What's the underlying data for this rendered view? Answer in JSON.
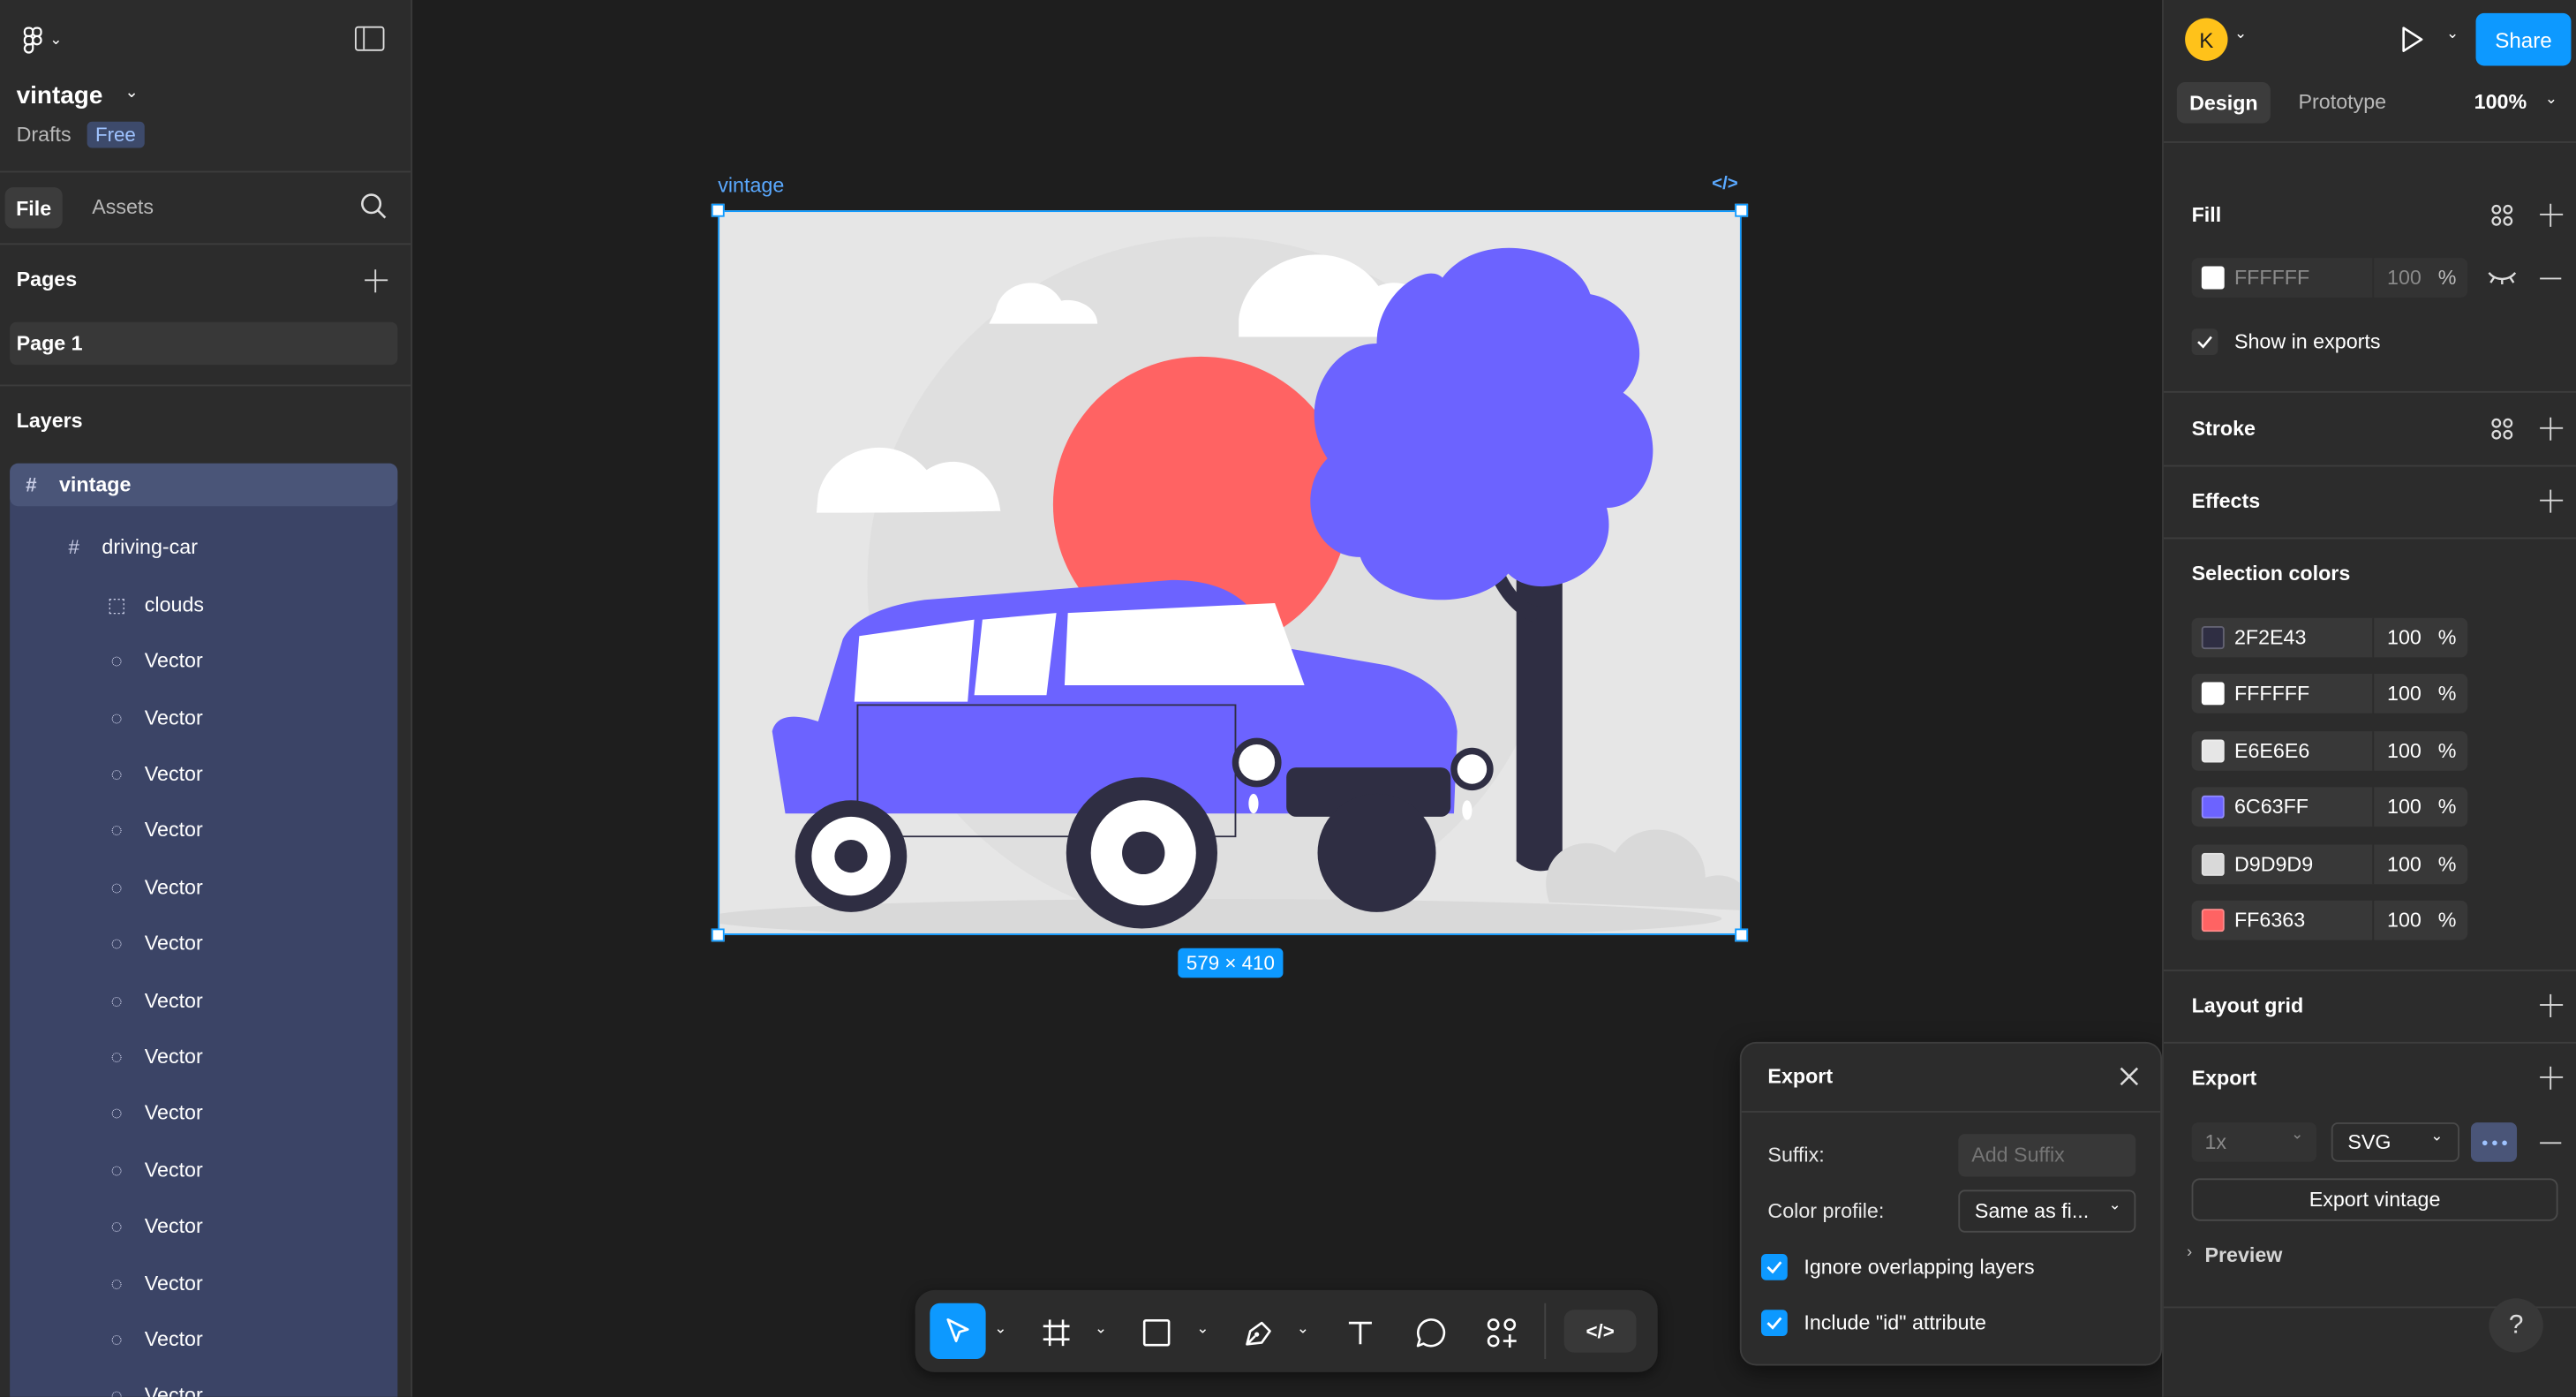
{
  "left_panel": {
    "file_name": "vintage",
    "location": "Drafts",
    "plan_badge": "Free",
    "tabs": [
      "File",
      "Assets"
    ],
    "pages_title": "Pages",
    "pages": [
      "Page 1"
    ],
    "layers_title": "Layers",
    "layers": [
      {
        "name": "vintage",
        "icon": "frame-icon"
      },
      {
        "name": "driving-car",
        "icon": "frame-icon"
      },
      {
        "name": "clouds",
        "icon": "group-icon"
      },
      {
        "name": "Vector",
        "icon": "vector-icon"
      },
      {
        "name": "Vector",
        "icon": "vector-icon"
      },
      {
        "name": "Vector",
        "icon": "vector-icon"
      },
      {
        "name": "Vector",
        "icon": "vector-icon"
      },
      {
        "name": "Vector",
        "icon": "vector-icon"
      },
      {
        "name": "Vector",
        "icon": "vector-icon"
      },
      {
        "name": "Vector",
        "icon": "vector-icon"
      },
      {
        "name": "Vector",
        "icon": "vector-icon"
      },
      {
        "name": "Vector",
        "icon": "vector-icon"
      },
      {
        "name": "Vector",
        "icon": "vector-icon"
      },
      {
        "name": "Vector",
        "icon": "vector-icon"
      },
      {
        "name": "Vector",
        "icon": "vector-icon"
      },
      {
        "name": "Vector",
        "icon": "vector-icon"
      },
      {
        "name": "Vector",
        "icon": "vector-icon"
      }
    ]
  },
  "canvas": {
    "frame_label": "vintage",
    "size_badge": "579 × 410",
    "code_icon": "code-icon"
  },
  "toolbar": {
    "tools": [
      "move-tool",
      "frame-tool",
      "shape-tool",
      "pen-tool",
      "text-tool",
      "comment-tool",
      "actions-tool",
      "dev-mode-toggle"
    ]
  },
  "export_popup": {
    "title": "Export",
    "suffix_label": "Suffix:",
    "suffix_placeholder": "Add Suffix",
    "color_profile_label": "Color profile:",
    "color_profile_value": "Same as fi...",
    "ignore_overlapping": "Ignore overlapping layers",
    "include_id": "Include \"id\" attribute"
  },
  "right_panel": {
    "avatar_initial": "K",
    "share_label": "Share",
    "tabs": [
      "Design",
      "Prototype"
    ],
    "zoom": "100%",
    "fill_title": "Fill",
    "fill": {
      "hex": "FFFFFF",
      "opacity": "100",
      "percent": "%"
    },
    "show_in_exports": "Show in exports",
    "stroke_title": "Stroke",
    "effects_title": "Effects",
    "selection_colors_title": "Selection colors",
    "selection_colors": [
      {
        "hex": "2F2E43",
        "opacity": "100",
        "percent": "%",
        "color": "#2F2E43"
      },
      {
        "hex": "FFFFFF",
        "opacity": "100",
        "percent": "%",
        "color": "#FFFFFF"
      },
      {
        "hex": "E6E6E6",
        "opacity": "100",
        "percent": "%",
        "color": "#E6E6E6"
      },
      {
        "hex": "6C63FF",
        "opacity": "100",
        "percent": "%",
        "color": "#6C63FF"
      },
      {
        "hex": "D9D9D9",
        "opacity": "100",
        "percent": "%",
        "color": "#D9D9D9"
      },
      {
        "hex": "FF6363",
        "opacity": "100",
        "percent": "%",
        "color": "#FF6363"
      }
    ],
    "layout_grid_title": "Layout grid",
    "export_title": "Export",
    "export_scale": "1x",
    "export_format": "SVG",
    "export_button": "Export vintage",
    "preview_label": "Preview",
    "help": "?"
  },
  "colors": {
    "accent": "#0d99ff",
    "layer_selected": "#4a5578",
    "layer_child": "#3b4466",
    "purple": "#6C63FF",
    "red": "#FF6363",
    "dark": "#2F2E43"
  }
}
